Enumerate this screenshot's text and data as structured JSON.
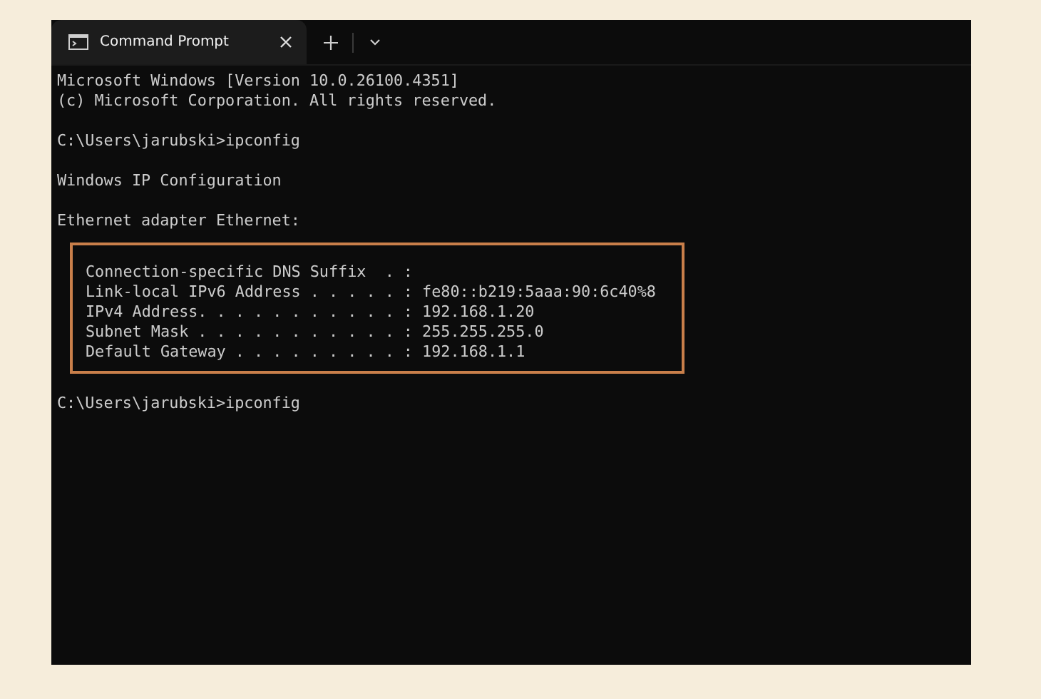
{
  "window": {
    "tab": {
      "title": "Command Prompt",
      "selected": true
    }
  },
  "terminal": {
    "blocks": [
      {
        "lines": [
          "Microsoft Windows [Version 10.0.26100.4351]",
          "(c) Microsoft Corporation. All rights reserved."
        ],
        "highlighted": false
      },
      {
        "lines": [
          "C:\\Users\\jarubski>ipconfig"
        ],
        "highlighted": false
      },
      {
        "lines": [
          "Windows IP Configuration"
        ],
        "highlighted": false
      },
      {
        "lines": [
          "Ethernet adapter Ethernet:"
        ],
        "highlighted": false
      },
      {
        "lines": [
          "Connection-specific DNS Suffix  . :",
          "Link-local IPv6 Address . . . . . : fe80::b219:5aaa:90:6c40%8",
          "IPv4 Address. . . . . . . . . . . : 192.168.1.20",
          "Subnet Mask . . . . . . . . . . . : 255.255.255.0",
          "Default Gateway . . . . . . . . . : 192.168.1.1"
        ],
        "highlighted": true
      },
      {
        "lines": [
          "C:\\Users\\jarubski>ipconfig"
        ],
        "highlighted": false
      }
    ]
  }
}
